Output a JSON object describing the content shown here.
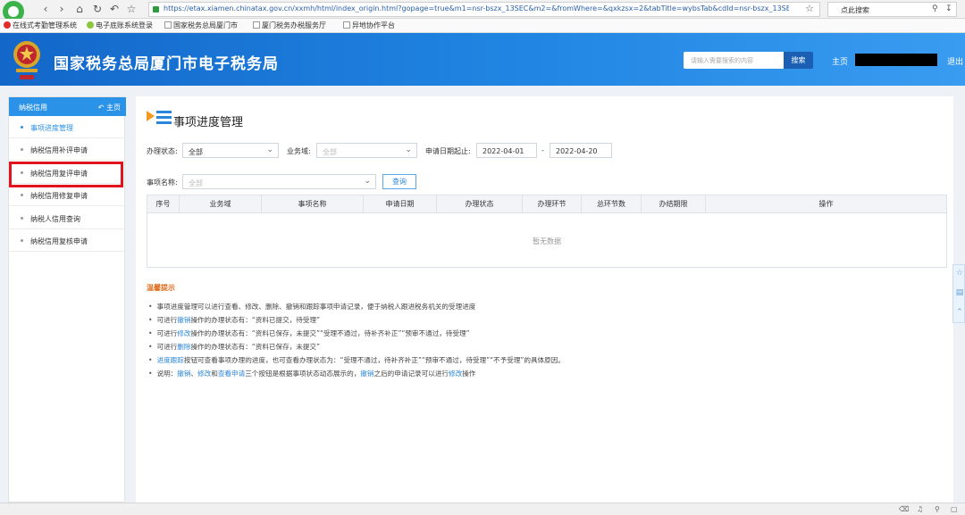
{
  "browser": {
    "url": "https://etax.xiamen.chinatax.gov.cn/xxmh/html/index_origin.html?gopage=true&m1=nsr-bszx_13SEC&m2=&fromWhere=&qxkzsx=2&tabTitle=wybsTab&cdId=nsr-bszx_13SEC&gnDm=nsr-l",
    "search_text": "点此搜索",
    "bookmarks": [
      "在线式考勤管理系统",
      "电子底账系统登录",
      "国家税务总局厦门市",
      "厦门税务办税服务厅",
      "异地协作平台"
    ]
  },
  "header": {
    "site_title": "国家税务总局厦门市电子税务局",
    "search_placeholder": "请输入需要搜索的内容",
    "search_button": "搜索",
    "home": "主页",
    "logout": "退出"
  },
  "sidebar": {
    "title": "纳税信用",
    "home": "主页",
    "items": [
      {
        "label": "事项进度管理"
      },
      {
        "label": "纳税信用补评申请"
      },
      {
        "label": "纳税信用复评申请"
      },
      {
        "label": "纳税信用修复申请"
      },
      {
        "label": "纳税人信用查询"
      },
      {
        "label": "纳税信用复核申请"
      }
    ]
  },
  "main": {
    "page_title": "事项进度管理",
    "filters": {
      "status_label": "办理状态:",
      "status_value": "全部",
      "domain_label": "业务域:",
      "domain_placeholder": "全部",
      "date_label": "申请日期起止:",
      "date_from": "2022-04-01",
      "date_sep": "-",
      "date_to": "2022-04-20",
      "item_label": "事项名称:",
      "item_placeholder": "全部",
      "query_button": "查询"
    },
    "table": {
      "columns": [
        "序号",
        "业务域",
        "事项名称",
        "申请日期",
        "办理状态",
        "办理环节",
        "总环节数",
        "办结期限",
        "操作"
      ],
      "empty_text": "暂无数据"
    },
    "tips": {
      "title": "温馨提示",
      "line1": "事项进度管理可以进行查看、修改、删除、撤销和跟踪事项申请记录，便于纳税人跟进税务机关的受理进度",
      "line2_pre": "可进行",
      "line2_link": "撤销",
      "line2_post": "操作的办理状态有：“资料已提交，待受理”",
      "line3_pre": "可进行",
      "line3_link": "修改",
      "line3_post": "操作的办理状态有：“资料已保存，未提交”“受理不通过，待补齐补正”“预审不通过，待受理”",
      "line4_pre": "可进行",
      "line4_link": "删除",
      "line4_post": "操作的办理状态有：“资料已保存，未提交”",
      "line5_link": "进度跟踪",
      "line5_post": "按钮可查看事项办理的进度，也可查看办理状态为：“受理不通过，待补齐补正”“预审不通过，待受理”“不予受理”的具体原因。",
      "line6_pre": "说明：",
      "line6_link1": "撤销",
      "line6_sep1": "、",
      "line6_link2": "修改",
      "line6_sep2": "和",
      "line6_link3": "查看申请",
      "line6_mid": "三个按钮是根据事项状态动态展示的，",
      "line6_link4": "撤销",
      "line6_mid2": "之后的申请记录可以进行",
      "line6_link5": "修改",
      "line6_end": "操作"
    }
  },
  "colors": {
    "header_blue": "#1367c9",
    "accent": "#2a93e8",
    "highlight_red": "#e0141e",
    "tips_orange": "#e06b1a"
  }
}
